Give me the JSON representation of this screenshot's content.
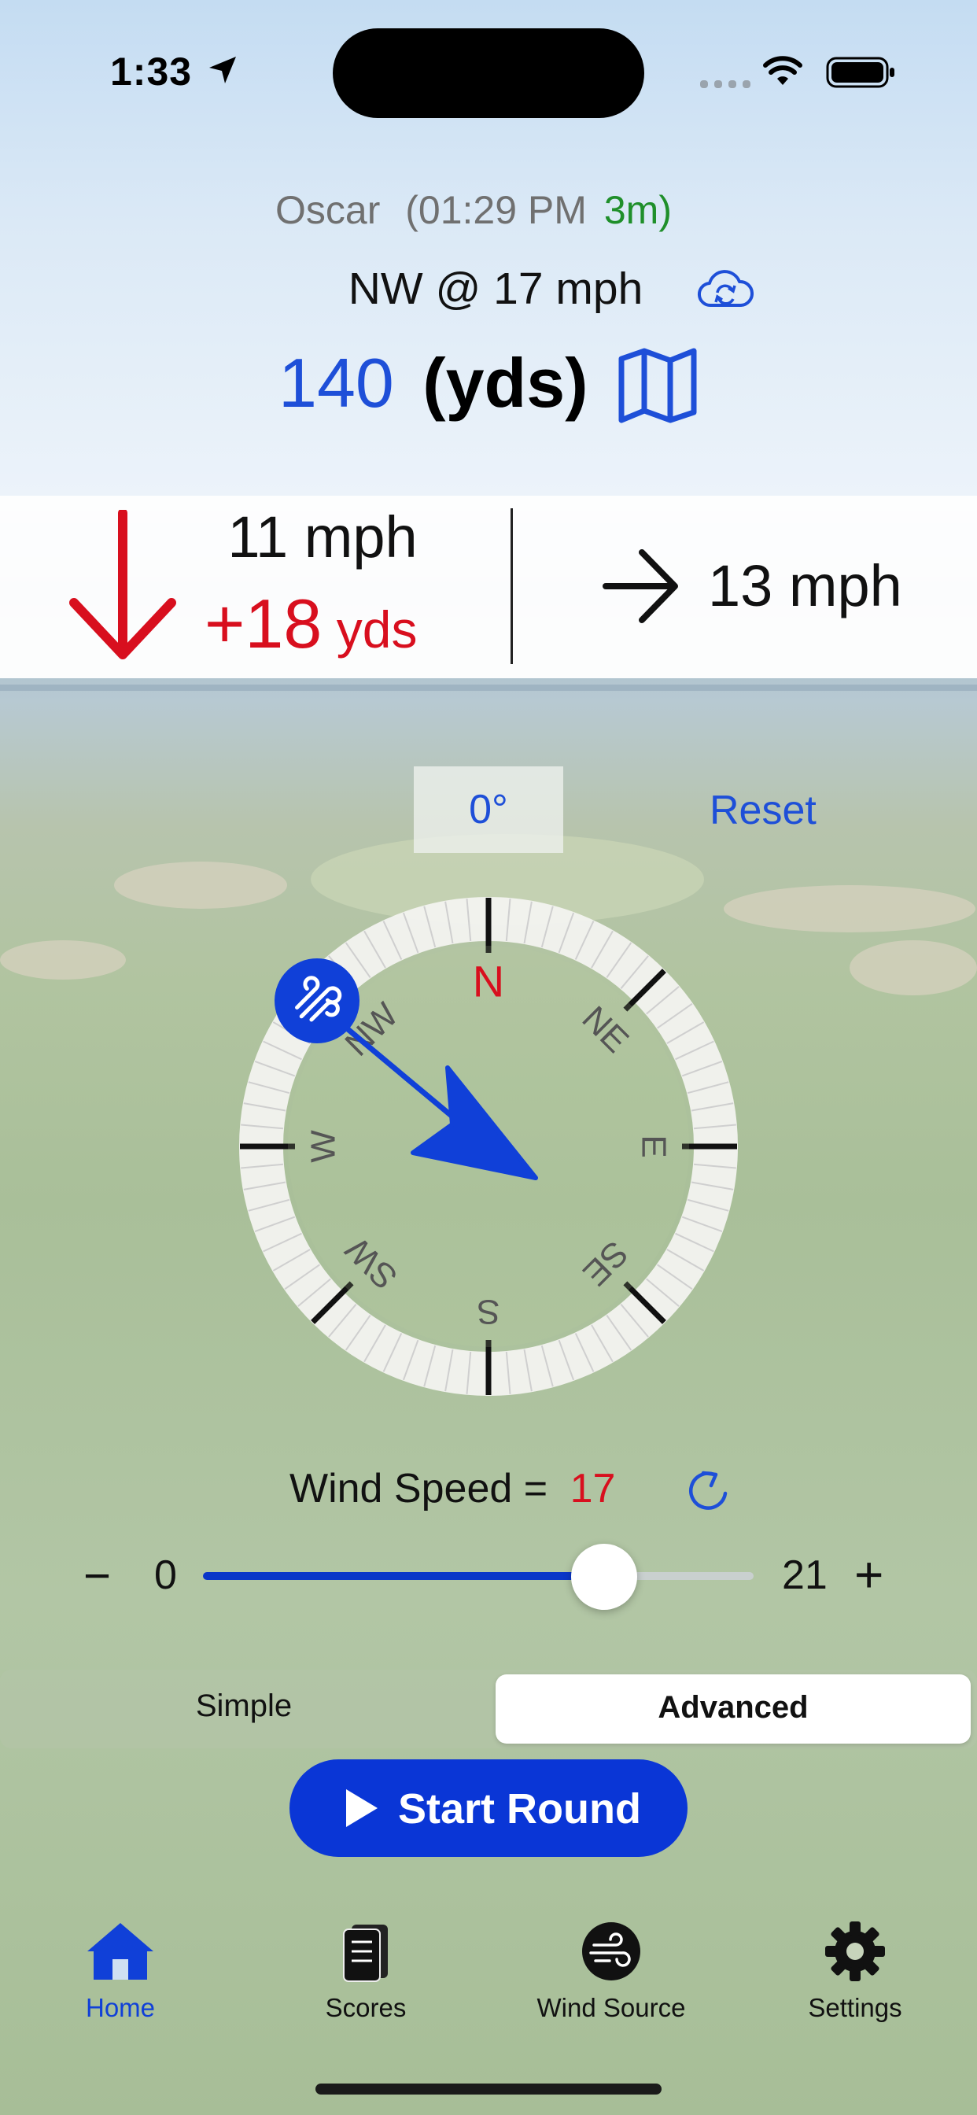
{
  "status_bar": {
    "time": "1:33"
  },
  "header": {
    "station": "Oscar",
    "time_prefix": "(01:29 PM",
    "age": "3m",
    "age_suffix": ")",
    "wind_summary": "NW @ 17 mph",
    "distance_value": "140",
    "distance_unit": "(yds)"
  },
  "wind_effect": {
    "headwind_speed": "11 mph",
    "yards_adjust": "+18",
    "yards_unit": "yds",
    "crosswind_speed": "13",
    "crosswind_unit": "mph"
  },
  "compass": {
    "heading_label": "0°",
    "reset_label": "Reset",
    "cardinals": [
      "N",
      "NE",
      "E",
      "SE",
      "S",
      "SW",
      "W",
      "NW"
    ],
    "wind_direction_degrees": 315
  },
  "wind_speed": {
    "label": "Wind Speed =",
    "value": "17",
    "min": "0",
    "max": "21",
    "minus_symbol": "−",
    "plus_symbol": "+",
    "fraction": 0.81
  },
  "mode": {
    "simple_label": "Simple",
    "advanced_label": "Advanced",
    "selected": "Advanced"
  },
  "start_button": {
    "label": "Start Round"
  },
  "tabs": [
    {
      "label": "Home",
      "icon": "house-icon",
      "active": true
    },
    {
      "label": "Scores",
      "icon": "scorecard-icon",
      "active": false
    },
    {
      "label": "Wind Source",
      "icon": "wind-icon",
      "active": false
    },
    {
      "label": "Settings",
      "icon": "gear-icon",
      "active": false
    }
  ],
  "colors": {
    "accent": "#0a36d6",
    "alert": "#d80f1e",
    "fresh": "#1f8f2a"
  }
}
